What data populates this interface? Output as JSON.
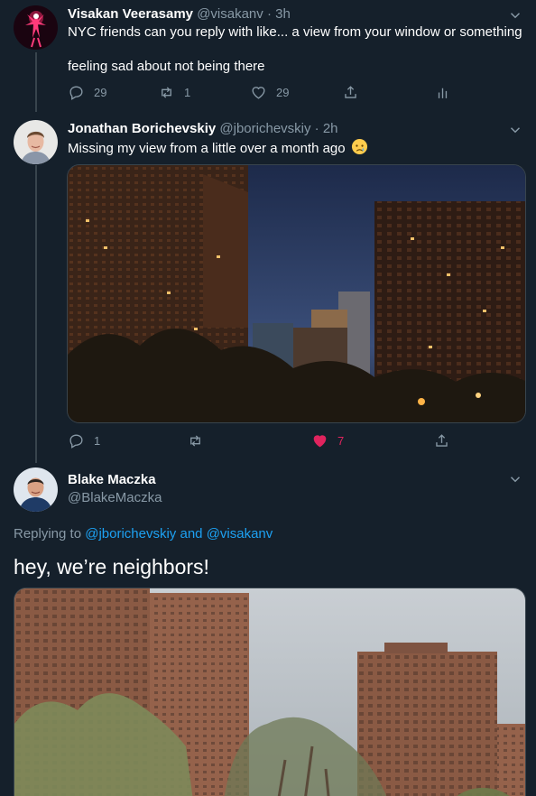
{
  "tweets": [
    {
      "display_name": "Visakan Veerasamy",
      "handle": "@visakanv",
      "time": "3h",
      "lines": [
        "NYC friends can you reply with like... a view from your window or something",
        "feeling sad about not being there"
      ],
      "replies": "29",
      "retweets": "1",
      "likes": "29"
    },
    {
      "display_name": "Jonathan Borichevskiy",
      "handle": "@jborichevskiy",
      "time": "2h",
      "text": "Missing my view from a little over a month ago",
      "emoji": "crying-face",
      "replies": "1",
      "likes": "7"
    },
    {
      "display_name": "Blake Maczka",
      "handle": "@BlakeMaczka",
      "replying_prefix": "Replying to ",
      "replying_user1": "@jborichevskiy",
      "replying_and": " and ",
      "replying_user2": "@visakanv",
      "text": "hey, we’re neighbors!"
    }
  ],
  "icons": {
    "reply": "reply-icon",
    "retweet": "retweet-icon",
    "like": "heart-icon",
    "share": "share-icon",
    "analytics": "analytics-icon",
    "caret": "chevron-down-icon"
  },
  "colors": {
    "background": "#15202b",
    "border": "#38444d",
    "secondary_text": "#8899a6",
    "link": "#1da1f2",
    "like": "#e0245e"
  }
}
